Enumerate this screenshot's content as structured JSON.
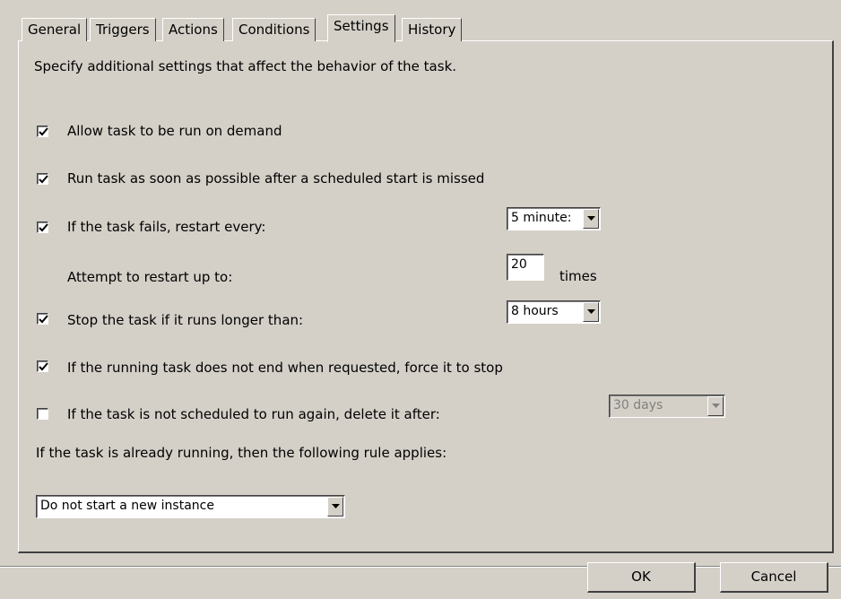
{
  "tabs": [
    "General",
    "Triggers",
    "Actions",
    "Conditions",
    "Settings",
    "History"
  ],
  "active_tab": "Settings",
  "description": "Specify additional settings that affect the behavior of the task.",
  "settings": {
    "allow_on_demand": {
      "label": "Allow task to be run on demand",
      "checked": true
    },
    "run_asap_missed": {
      "label": "Run task as soon as possible after a scheduled start is missed",
      "checked": true
    },
    "restart_every": {
      "label": "If the task fails, restart every:",
      "checked": true,
      "value": "5 minute:"
    },
    "restart_attempts": {
      "label": "Attempt to restart up to:",
      "value": "20",
      "unit": "times"
    },
    "stop_if_longer": {
      "label": "Stop the task if it runs longer than:",
      "checked": true,
      "value": "8 hours"
    },
    "force_stop": {
      "label": "If the running task does not end when requested, force it to stop",
      "checked": true
    },
    "delete_after": {
      "label": "If the task is not scheduled to run again, delete it after:",
      "checked": false,
      "value": "30 days",
      "disabled": true
    },
    "running_rule": {
      "label": "If the task is already running, then the following rule applies:",
      "value": "Do not start a new instance"
    }
  },
  "buttons": {
    "ok": "OK",
    "cancel": "Cancel"
  }
}
